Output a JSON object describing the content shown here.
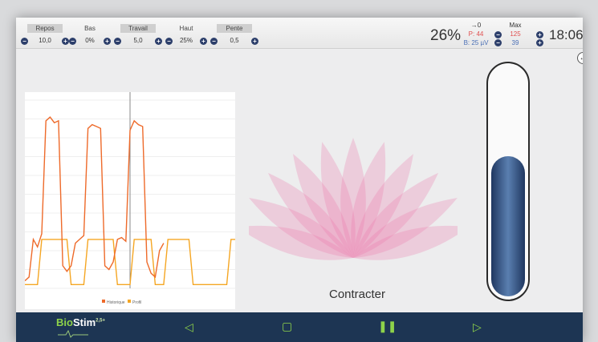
{
  "params": [
    {
      "label": "Repos",
      "value": "10,0"
    },
    {
      "label": "Bas",
      "value": "0%"
    },
    {
      "label": "Travail",
      "value": "5,0"
    },
    {
      "label": "Haut",
      "value": "25%"
    },
    {
      "label": "Pente",
      "value": "0,5"
    }
  ],
  "header": {
    "percent": "26%",
    "arrow_label": "→0",
    "p_value": "P: 44",
    "b_value": "B: 25 µV",
    "max_label": "Max",
    "max_value": "125",
    "max_sub": "39",
    "time": "18:06"
  },
  "icons": {
    "back": "back-arrow-icon",
    "minus": "minus-circle-icon",
    "plus": "plus-circle-icon"
  },
  "chart_data": {
    "type": "line",
    "x": [
      0,
      2,
      4,
      6,
      8,
      10,
      12,
      14,
      16,
      18,
      20,
      22,
      24,
      26,
      28,
      30,
      32,
      34,
      36,
      38,
      40,
      42,
      44,
      46,
      48,
      50,
      52,
      54,
      56,
      58,
      60,
      62,
      64,
      66,
      68,
      70,
      72,
      74,
      76,
      78,
      80,
      82,
      84,
      86,
      88,
      90,
      92,
      94,
      96,
      98,
      100
    ],
    "ylim": [
      0,
      10
    ],
    "series": [
      {
        "name": "Historique",
        "color": "#ee6a2a",
        "values": [
          0.4,
          0.6,
          2.6,
          2.2,
          2.9,
          8.9,
          9.1,
          8.8,
          8.9,
          1.2,
          0.9,
          1.2,
          2.4,
          2.6,
          2.8,
          8.5,
          8.7,
          8.6,
          8.5,
          1.2,
          1.0,
          1.4,
          2.6,
          2.7,
          2.5,
          8.4,
          8.9,
          8.7,
          8.6,
          1.4,
          0.8,
          0.6,
          2.0,
          2.4,
          null,
          null,
          null,
          null,
          null,
          null,
          null,
          null,
          null,
          null,
          null,
          null,
          null,
          null,
          null,
          null,
          null
        ]
      },
      {
        "name": "Profil",
        "color": "#f5a623",
        "values": [
          0.2,
          0.2,
          0.2,
          0.2,
          2.6,
          2.6,
          2.6,
          2.6,
          2.6,
          2.6,
          2.6,
          0.2,
          0.2,
          0.2,
          0.2,
          2.6,
          2.6,
          2.6,
          2.6,
          2.6,
          2.6,
          2.6,
          0.2,
          0.2,
          0.2,
          0.2,
          2.6,
          2.6,
          2.6,
          2.6,
          2.6,
          0.2,
          0.2,
          0.2,
          2.6,
          2.6,
          2.6,
          2.6,
          2.6,
          2.6,
          0.2,
          0.2,
          0.2,
          0.2,
          0.2,
          0.2,
          0.2,
          0.2,
          0.2,
          2.6,
          2.6
        ]
      }
    ],
    "cursor_x": 50,
    "legend": "bottom-center",
    "grid": true
  },
  "status": "Contracter",
  "gauge_level": 0.62,
  "brand": {
    "name_part1": "Bio",
    "name_part2": "Stim",
    "version": "2,5+"
  }
}
